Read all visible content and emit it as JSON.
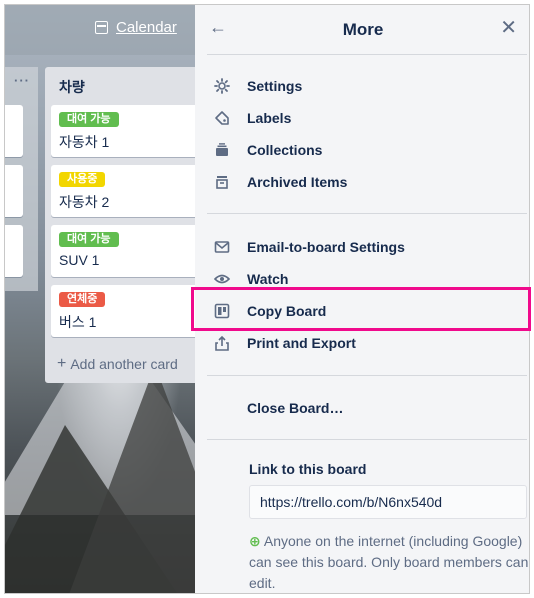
{
  "header": {
    "calendar_label": "Calendar"
  },
  "board_list": {
    "title": "차량",
    "more_dots": "···",
    "cards": [
      {
        "label": "대여 가능",
        "label_color": "#61bd4f",
        "title": "자동차 1"
      },
      {
        "label": "사용중",
        "label_color": "#f2d600",
        "title": "자동차 2"
      },
      {
        "label": "대여 가능",
        "label_color": "#61bd4f",
        "title": "SUV 1"
      },
      {
        "label": "연체중",
        "label_color": "#eb5a46",
        "title": "버스 1"
      }
    ],
    "add_card": "Add another card"
  },
  "panel": {
    "title": "More",
    "back_icon": "arrow-left-icon",
    "close_icon": "close-icon",
    "group1": [
      {
        "label": "Settings",
        "icon": "gear-icon"
      },
      {
        "label": "Labels",
        "icon": "tag-icon"
      },
      {
        "label": "Collections",
        "icon": "collections-icon"
      },
      {
        "label": "Archived Items",
        "icon": "archive-icon"
      }
    ],
    "group2": [
      {
        "label": "Email-to-board Settings",
        "icon": "mail-icon"
      },
      {
        "label": "Watch",
        "icon": "eye-icon"
      },
      {
        "label": "Copy Board",
        "icon": "board-icon"
      },
      {
        "label": "Print and Export",
        "icon": "share-icon"
      }
    ],
    "close_board": "Close Board…",
    "link_heading": "Link to this board",
    "link_value": "https://trello.com/b/N6nx540d",
    "info_text": "Anyone on the internet (including Google) can see this board. Only board members can edit."
  },
  "highlight_color": "#f00a8c"
}
